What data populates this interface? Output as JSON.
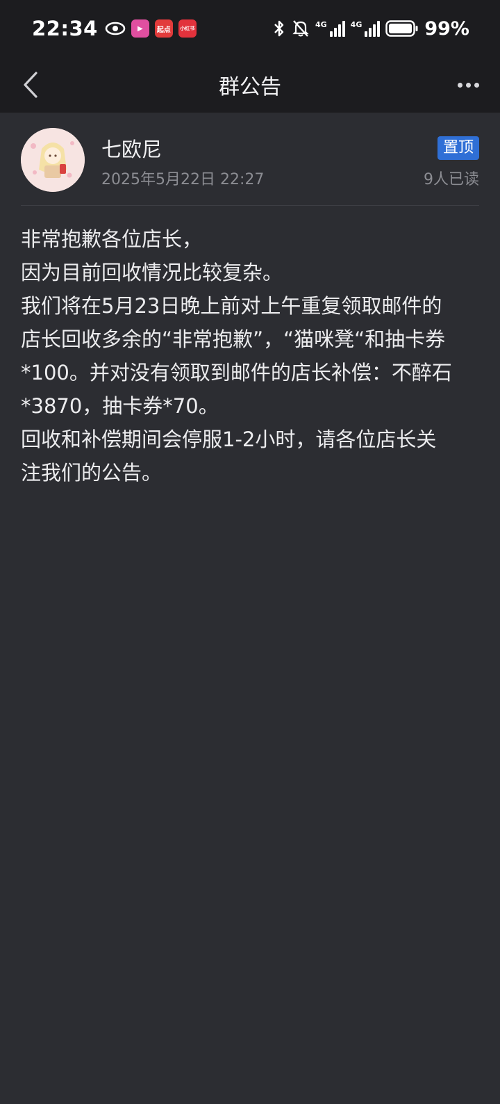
{
  "status_bar": {
    "time": "22:34",
    "apps": [
      {
        "name": "video-app",
        "label": "▶",
        "color": "#e04fa0"
      },
      {
        "name": "qidian-app",
        "label": "起点",
        "color": "#e23b3b"
      },
      {
        "name": "xiaohongshu-app",
        "label": "小红书",
        "color": "#e2323c"
      }
    ],
    "network_1": "4G",
    "network_2": "4G",
    "battery": "99%"
  },
  "header": {
    "title": "群公告"
  },
  "announcement": {
    "author": "七欧尼",
    "timestamp": "2025年5月22日 22:27",
    "badge": "置顶",
    "read_count": "9人已读",
    "lines": [
      "非常抱歉各位店长，",
      "因为目前回收情况比较复杂。",
      "我们将在5月23日晚上前对上午重复领取邮件的",
      "店长回收多余的“非常抱歉”，“猫咪凳“和抽卡券",
      "*100。并对没有领取到邮件的店长补偿：不醉石",
      "*3870，抽卡券*70。",
      "回收和补偿期间会停服1-2小时，请各位店长关",
      "注我们的公告。"
    ]
  },
  "colors": {
    "background": "#2c2d32",
    "bar": "#1c1c1f",
    "badge": "#2f6fd6"
  }
}
